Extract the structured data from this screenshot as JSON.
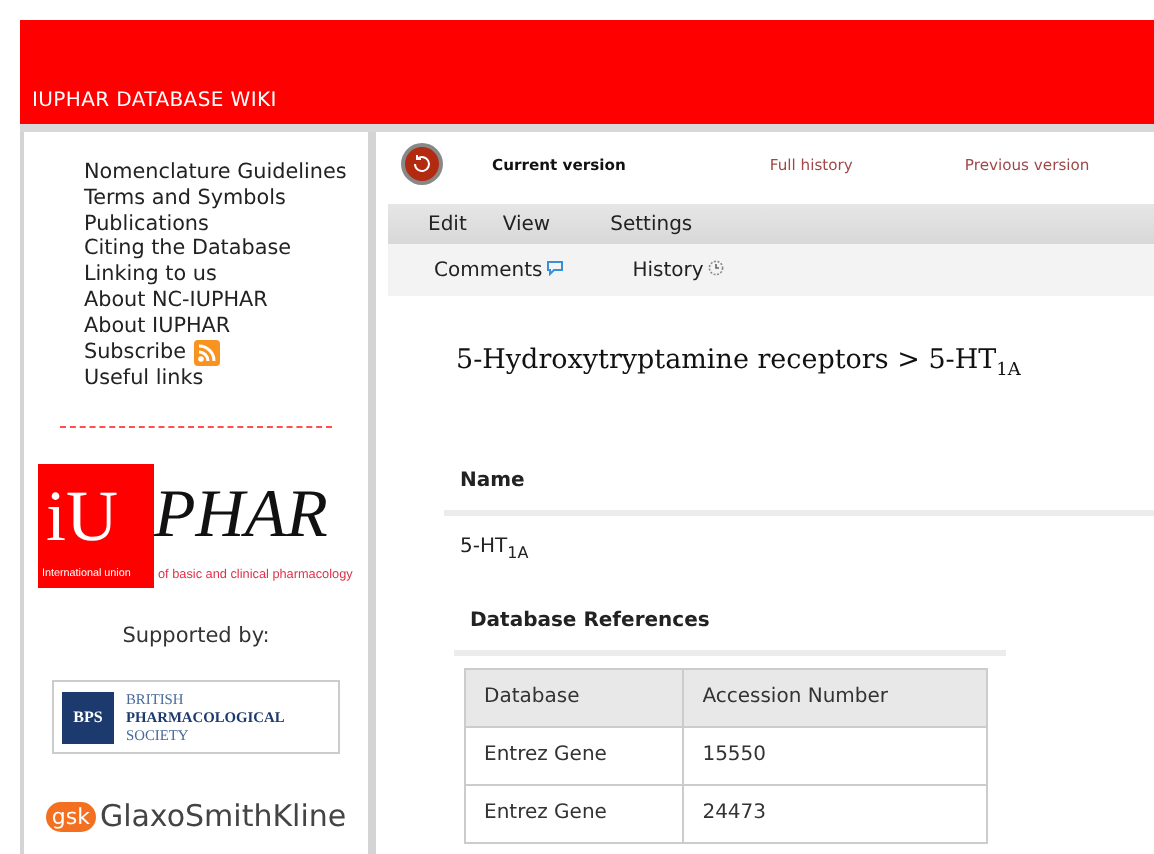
{
  "header": {
    "title": "IUPHAR DATABASE WIKI"
  },
  "sidebar": {
    "links": [
      {
        "label": "Nomenclature Guidelines",
        "kind": "plain"
      },
      {
        "label": "Terms and Symbols",
        "kind": "plain"
      },
      {
        "label": "Publications",
        "kind": "plain"
      },
      {
        "label": "Citing the Database",
        "kind": "plain"
      },
      {
        "label": "Linking to us",
        "kind": "plain"
      },
      {
        "label": "About NC-IUPHAR",
        "kind": "plain"
      },
      {
        "label": "About IUPHAR",
        "kind": "plain"
      },
      {
        "label": "Subscribe",
        "kind": "feed"
      },
      {
        "label": "Useful links",
        "kind": "plain"
      }
    ],
    "iuphar_logo": {
      "initials": "iU",
      "name": "PHAR",
      "tag_left": "International union",
      "tag_right": "of basic and clinical pharmacology"
    },
    "supported_by": "Supported by:",
    "bps_logo": {
      "mark": "BPS",
      "lines": [
        "BRITISH",
        "PHARMACOLOGICAL",
        "SOCIETY"
      ]
    },
    "gsk_logo": {
      "mark": "gsk",
      "name": "GlaxoSmithKline"
    }
  },
  "version_bar": {
    "items": [
      {
        "label": "Current version",
        "selected": true
      },
      {
        "label": "Full history",
        "selected": false
      },
      {
        "label": "Previous version",
        "selected": false
      }
    ]
  },
  "menu": [
    "Edit",
    "View",
    "Settings"
  ],
  "subnav": [
    {
      "label": "Comments",
      "kind": "comments"
    },
    {
      "label": "History",
      "kind": "history"
    }
  ],
  "heading": "5-Hydroxytryptamine receptors > 5-HT$_{1A}$",
  "name_section": {
    "title": "Name",
    "value": "5-HT$_{1A}$"
  },
  "references": {
    "title": "Database References",
    "columns": [
      "Database",
      "Accession Number"
    ],
    "rows": [
      [
        "Entrez Gene",
        "15550"
      ],
      [
        "Entrez Gene",
        "24473"
      ]
    ]
  }
}
